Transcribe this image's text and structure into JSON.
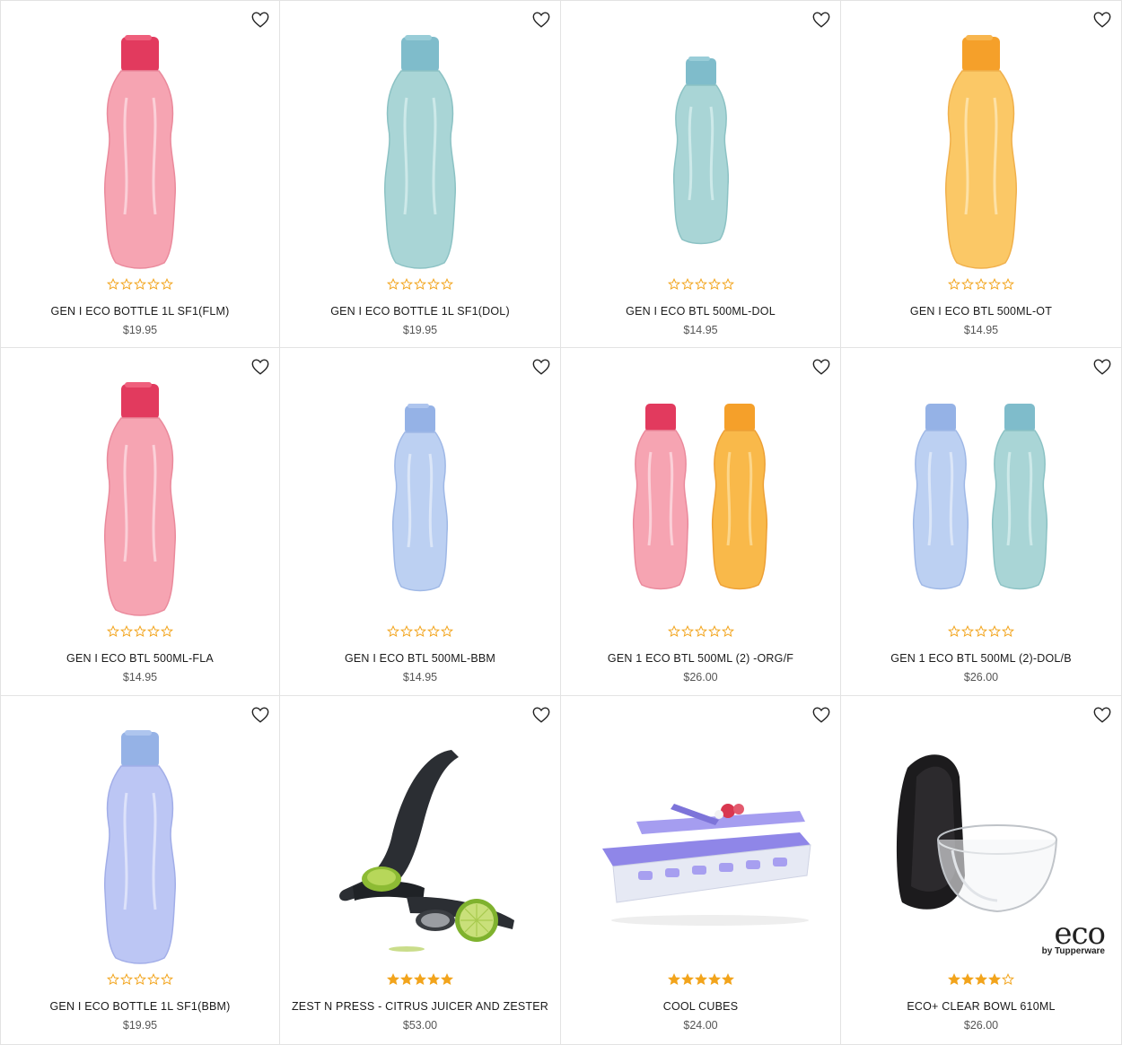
{
  "colors": {
    "star": "#f2a41c",
    "star_empty_stroke": "#f2a41c",
    "border": "#e3e3e3"
  },
  "products": [
    {
      "name": "GEN I ECO BOTTLE 1L SF1(FLM)",
      "price": "$19.95",
      "rating": 0,
      "image": "pink-bottle-1l-icon"
    },
    {
      "name": "GEN I ECO BOTTLE 1L SF1(DOL)",
      "price": "$19.95",
      "rating": 0,
      "image": "teal-bottle-1l-icon"
    },
    {
      "name": "GEN I ECO BTL 500ML-DOL",
      "price": "$14.95",
      "rating": 0,
      "image": "teal-bottle-500ml-icon"
    },
    {
      "name": "GEN I ECO BTL 500ML-OT",
      "price": "$14.95",
      "rating": 0,
      "image": "orange-bottle-1l-icon"
    },
    {
      "name": "GEN I ECO BTL 500ML-FLA",
      "price": "$14.95",
      "rating": 0,
      "image": "pink-bottle-1l-icon"
    },
    {
      "name": "GEN I ECO BTL 500ML-BBM",
      "price": "$14.95",
      "rating": 0,
      "image": "blue-bottle-500ml-icon"
    },
    {
      "name": "GEN 1 ECO BTL 500ML (2) -ORG/F",
      "price": "$26.00",
      "rating": 0,
      "image": "pink-orange-bottle-pair-icon"
    },
    {
      "name": "GEN 1 ECO BTL 500ML (2)-DOL/B",
      "price": "$26.00",
      "rating": 0,
      "image": "blue-teal-bottle-pair-icon"
    },
    {
      "name": "GEN I ECO BOTTLE 1L SF1(BBM)",
      "price": "$19.95",
      "rating": 0,
      "image": "blue-bottle-1l-icon"
    },
    {
      "name": "ZEST N PRESS - CITRUS JUICER AND ZESTER",
      "price": "$53.00",
      "rating": 5,
      "image": "citrus-juicer-icon"
    },
    {
      "name": "COOL CUBES",
      "price": "$24.00",
      "rating": 5,
      "image": "ice-cube-tray-icon"
    },
    {
      "name": "ECO+ CLEAR BOWL 610ML",
      "price": "$26.00",
      "rating": 4,
      "image": "clear-bowl-icon",
      "logo": {
        "brand": "eco",
        "byline": "by Tupperware"
      }
    }
  ]
}
